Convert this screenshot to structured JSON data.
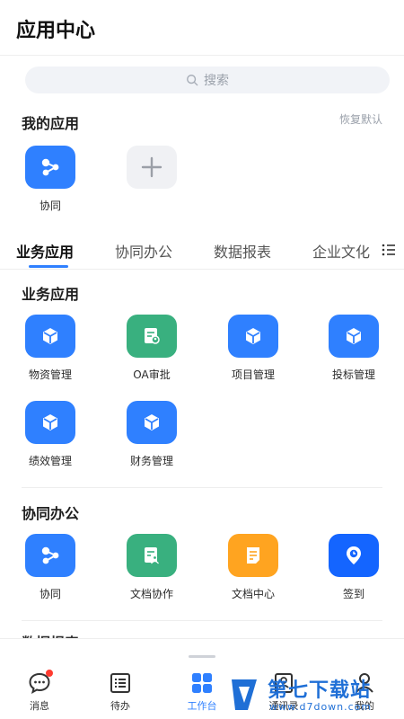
{
  "header": {
    "title": "应用中心"
  },
  "search": {
    "placeholder": "搜索"
  },
  "my_apps": {
    "title": "我的应用",
    "restore_label": "恢复默认",
    "items": [
      {
        "label": "协同",
        "icon": "share-nodes-icon",
        "color": "#2f80ff"
      },
      {
        "label": "",
        "icon": "plus-icon",
        "color": "#f0f1f4"
      }
    ]
  },
  "tabs": [
    {
      "label": "业务应用",
      "active": true
    },
    {
      "label": "协同办公",
      "active": false
    },
    {
      "label": "数据报表",
      "active": false
    },
    {
      "label": "企业文化",
      "active": false
    }
  ],
  "sections": [
    {
      "title": "业务应用",
      "items": [
        {
          "label": "物资管理",
          "icon": "cube-icon",
          "color": "#2f80ff"
        },
        {
          "label": "OA审批",
          "icon": "approval-doc-icon",
          "color": "#39b07f"
        },
        {
          "label": "项目管理",
          "icon": "cube-icon",
          "color": "#2f80ff"
        },
        {
          "label": "投标管理",
          "icon": "cube-icon",
          "color": "#2f80ff"
        },
        {
          "label": "绩效管理",
          "icon": "cube-icon",
          "color": "#2f80ff"
        },
        {
          "label": "财务管理",
          "icon": "cube-icon",
          "color": "#2f80ff"
        }
      ]
    },
    {
      "title": "协同办公",
      "items": [
        {
          "label": "协同",
          "icon": "share-nodes-icon",
          "color": "#2f80ff"
        },
        {
          "label": "文档协作",
          "icon": "doc-collab-icon",
          "color": "#39b07f"
        },
        {
          "label": "文档中心",
          "icon": "document-icon",
          "color": "#ffa420"
        },
        {
          "label": "签到",
          "icon": "location-clock-icon",
          "color": "#1465ff"
        }
      ]
    },
    {
      "title": "数据报表"
    }
  ],
  "bottom_nav": [
    {
      "label": "消息",
      "icon": "chat-bubble-icon",
      "active": false,
      "badge": true
    },
    {
      "label": "待办",
      "icon": "todo-list-icon",
      "active": false
    },
    {
      "label": "工作台",
      "icon": "workbench-grid-icon",
      "active": true
    },
    {
      "label": "通讯录",
      "icon": "contacts-icon",
      "active": false
    },
    {
      "label": "我的",
      "icon": "person-icon",
      "active": false
    }
  ],
  "watermark": {
    "text": "第七下载站",
    "url": "www.d7down.com"
  }
}
